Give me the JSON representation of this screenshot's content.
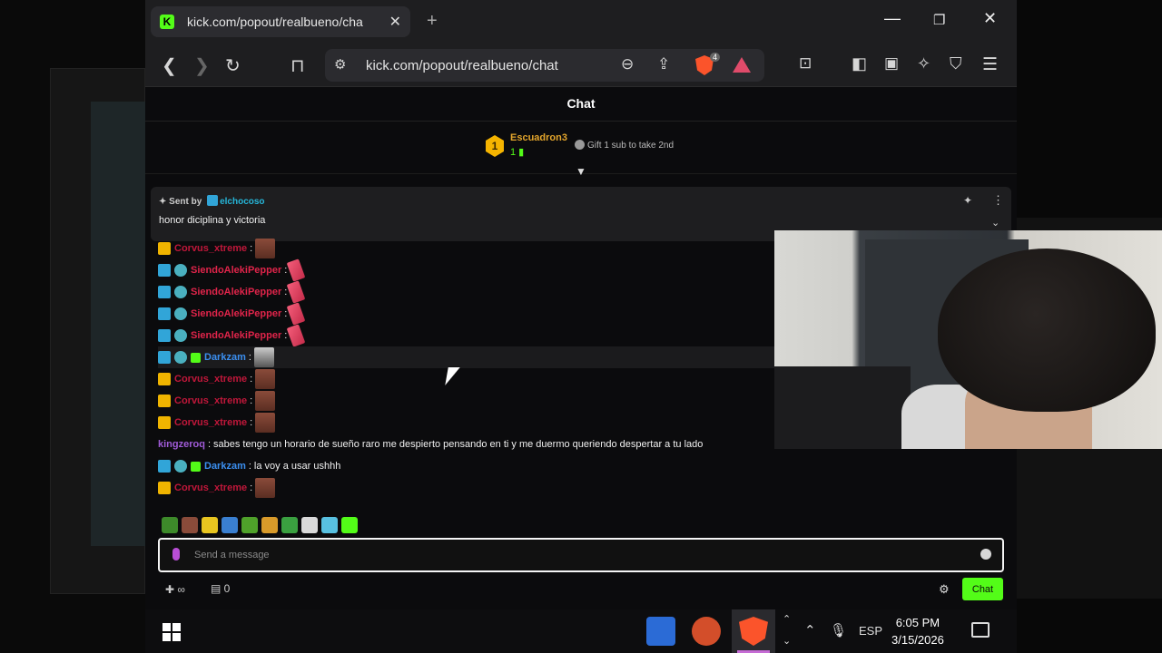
{
  "browser": {
    "tab_title": "kick.com/popout/realbueno/cha",
    "tab_close": "✕",
    "new_tab": "+",
    "address": "kick.com/popout/realbueno/chat",
    "shield_count": "4",
    "window_controls": {
      "minimize": "—",
      "restore": "❐",
      "close": "✕"
    }
  },
  "chat": {
    "header_title": "Chat",
    "leaderboard": {
      "rank": "1",
      "name": "Escuadron3",
      "count": "1",
      "gift_text": "Gift 1 sub to take 2nd"
    },
    "pinned": {
      "sent_by_label": "Sent by",
      "sender": "elchocoso",
      "message": "honor diciplina y victoria"
    },
    "messages": [
      {
        "user": "Corvus_xtreme",
        "color": "#c0173a",
        "badges": [
          "crown"
        ],
        "emote": "face",
        "text": ""
      },
      {
        "user": "SiendoAlekiPepper",
        "color": "#e0244a",
        "badges": [
          "mod",
          "sub"
        ],
        "emote": "fish",
        "text": ""
      },
      {
        "user": "SiendoAlekiPepper",
        "color": "#e0244a",
        "badges": [
          "mod",
          "sub"
        ],
        "emote": "fish",
        "text": ""
      },
      {
        "user": "SiendoAlekiPepper",
        "color": "#e0244a",
        "badges": [
          "mod",
          "sub"
        ],
        "emote": "fish",
        "text": ""
      },
      {
        "user": "SiendoAlekiPepper",
        "color": "#e0244a",
        "badges": [
          "mod",
          "sub"
        ],
        "emote": "fish",
        "text": ""
      },
      {
        "user": "Darkzam",
        "color": "#3b8ff0",
        "badges": [
          "mod",
          "sub",
          "gift"
        ],
        "emote": "dog",
        "text": ""
      },
      {
        "user": "Corvus_xtreme",
        "color": "#c0173a",
        "badges": [
          "crown"
        ],
        "emote": "face",
        "text": ""
      },
      {
        "user": "Corvus_xtreme",
        "color": "#c0173a",
        "badges": [
          "crown"
        ],
        "emote": "face",
        "text": ""
      },
      {
        "user": "Corvus_xtreme",
        "color": "#c0173a",
        "badges": [
          "crown"
        ],
        "emote": "face",
        "text": ""
      },
      {
        "user": "kingzeroq",
        "color": "#a05bd8",
        "badges": [],
        "emote": "",
        "text": "sabes tengo un horario de sueño raro me despierto pensando en ti y me duermo queriendo despertar a tu lado"
      },
      {
        "user": "Darkzam",
        "color": "#3b8ff0",
        "badges": [
          "mod",
          "sub",
          "gift"
        ],
        "emote": "",
        "text": "la voy a usar ushhh"
      },
      {
        "user": "Corvus_xtreme",
        "color": "#c0173a",
        "badges": [
          "crown"
        ],
        "emote": "face",
        "text": ""
      }
    ],
    "emote_bar_colors": [
      "#3d8a2a",
      "#8a4b3a",
      "#e8c520",
      "#3a7fd0",
      "#4fa12a",
      "#d89a2a",
      "#3aa040",
      "#d9d9d9",
      "#58c0e0",
      "#53fc18"
    ],
    "input_placeholder": "Send a message",
    "footer": {
      "viewers": "∞",
      "store_count": "0",
      "send_label": "Chat"
    }
  },
  "taskbar": {
    "language": "ESP",
    "time": "6:05 PM",
    "date": "3/15/2026"
  },
  "colors": {
    "kick_green": "#53fc18",
    "background": "#0b0b0d"
  }
}
